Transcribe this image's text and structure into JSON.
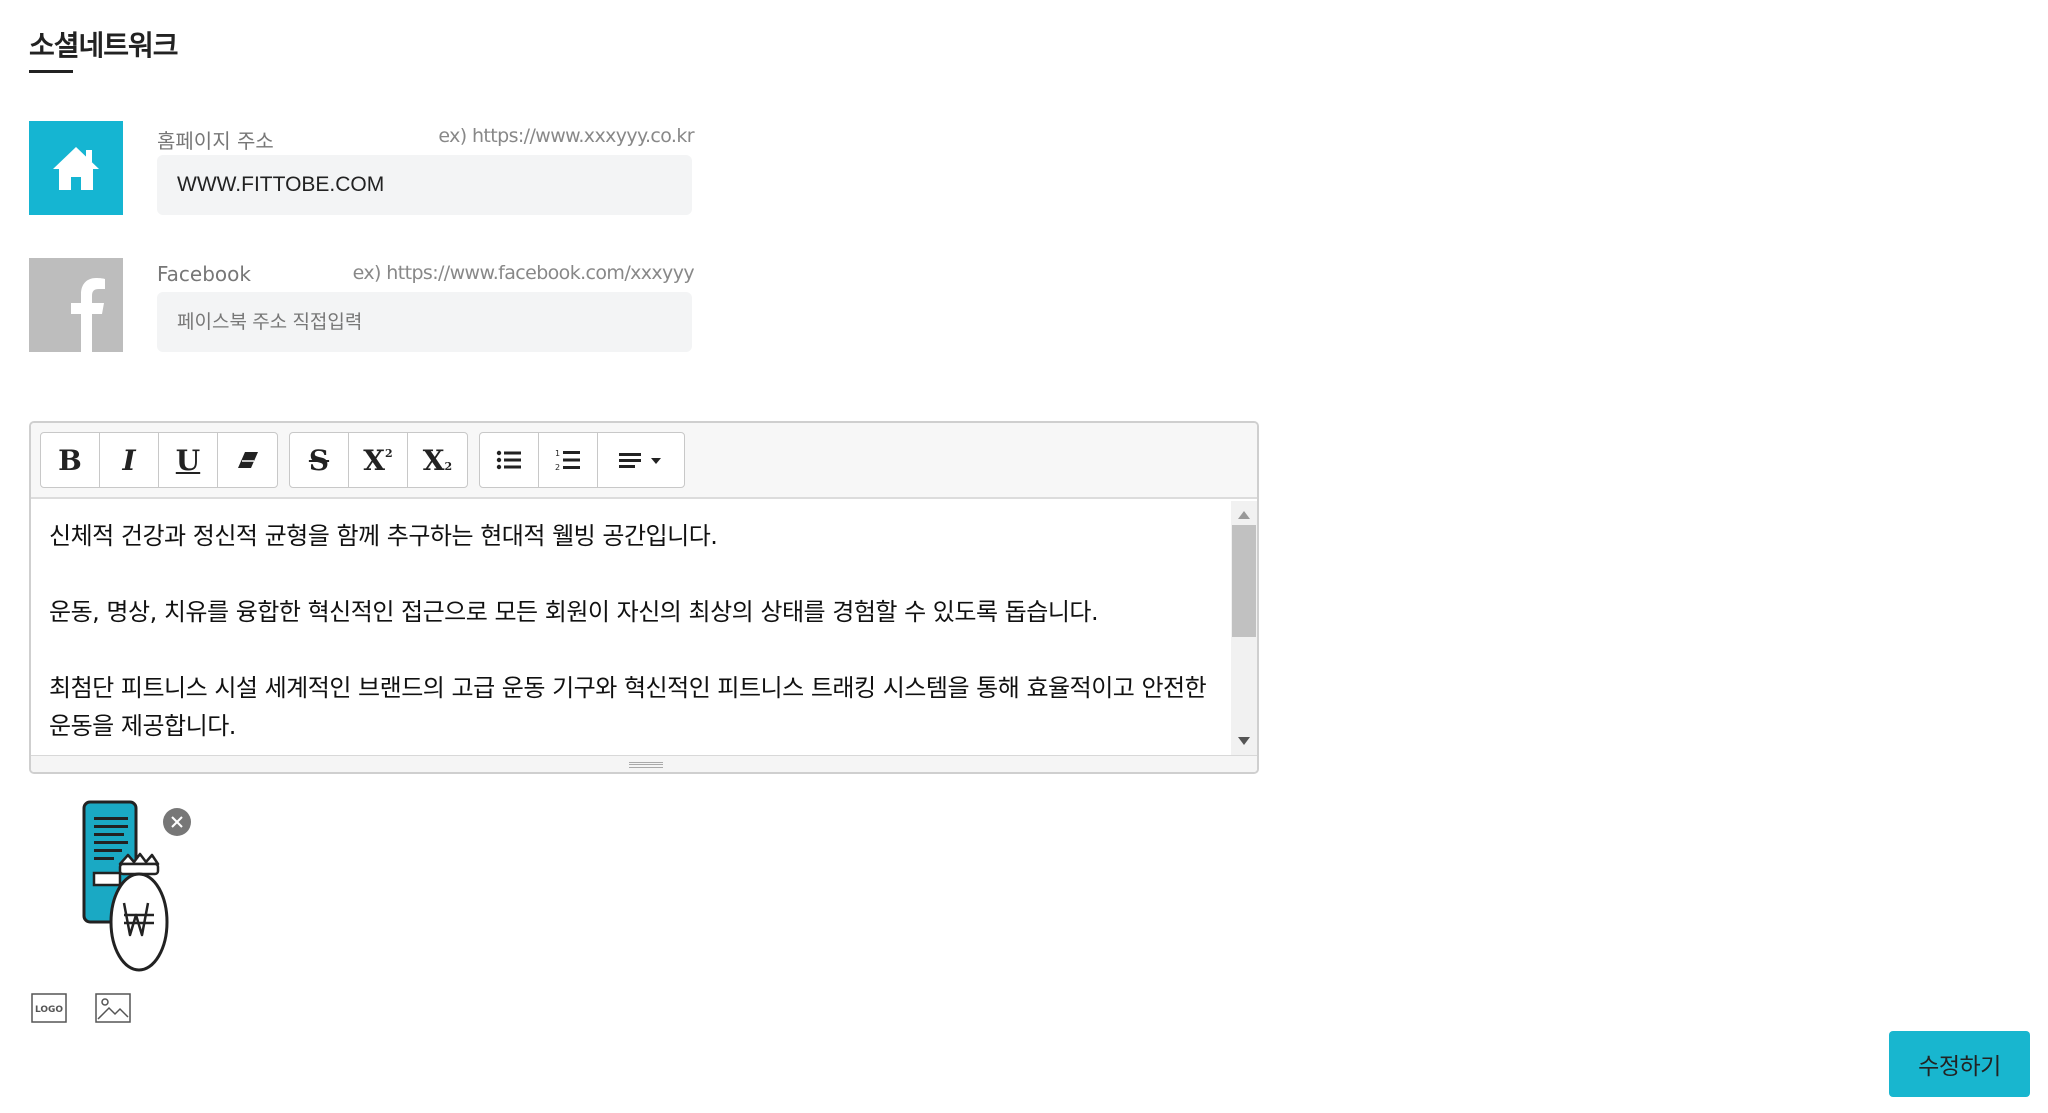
{
  "section": {
    "title": "소셜네트워크"
  },
  "homepage": {
    "label": "홈페이지 주소",
    "example": "ex) https://www.xxxyyy.co.kr",
    "value": "WWW.FITTOBE.COM",
    "placeholder": "",
    "icon": "home-icon",
    "icon_bg": "#15b5d2"
  },
  "facebook": {
    "label": "Facebook",
    "example": "ex) https://www.facebook.com/xxxyyy",
    "value": "",
    "placeholder": "페이스북 주소 직접입력",
    "icon": "facebook-icon",
    "icon_bg": "#bdbdbd"
  },
  "editor": {
    "toolbar": {
      "bold": "B",
      "italic": "I",
      "underline": "U",
      "eraser_icon": "eraser-icon",
      "strikethrough": "S",
      "superscript": "X",
      "subscript": "X",
      "unordered_list_icon": "list-ul-icon",
      "ordered_list_icon": "list-ol-icon",
      "align_icon": "align-left-icon"
    },
    "paragraphs": [
      "신체적 건강과 정신적 균형을 함께 추구하는 현대적 웰빙 공간입니다.",
      "운동, 명상, 치유를 융합한 혁신적인 접근으로 모든 회원이 자신의 최상의 상태를 경험할 수 있도록 돕습니다.",
      "최첨단 피트니스 시설 세계적인 브랜드의 고급 운동 기구와 혁신적인 피트니스 트래킹 시스템을 통해 효율적이고 안전한 운동을 제공합니다."
    ]
  },
  "attachment": {
    "icon": "document-money-bag-icon",
    "remove_icon": "close-icon"
  },
  "icons": {
    "logo": "LOGO",
    "image": "image-icon"
  },
  "submit": {
    "label": "수정하기"
  },
  "colors": {
    "accent": "#18b6cf",
    "home_icon_bg": "#15b5d2",
    "facebook_icon_bg": "#bdbdbd"
  }
}
